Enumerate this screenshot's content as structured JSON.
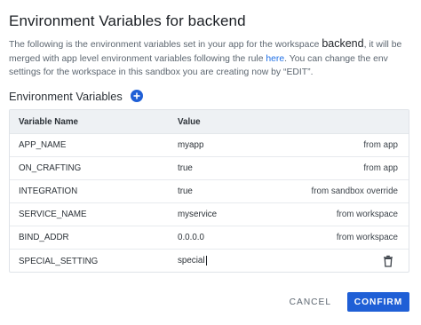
{
  "dialog": {
    "title": "Environment Variables for backend",
    "description": {
      "part1": "The following is the environment variables set in your app for the workspace ",
      "workspace": "backend",
      "part2": ", it will be merged with app level environment variables following the rule ",
      "link": "here",
      "part3": ". You can change the env settings for the workspace in this sandbox you are creating now by “EDIT”."
    }
  },
  "section": {
    "label": "Environment Variables",
    "add_icon": "plus-circle-icon"
  },
  "table": {
    "headers": {
      "name": "Variable Name",
      "value": "Value"
    },
    "rows": [
      {
        "name": "APP_NAME",
        "value": "myapp",
        "source": "from app"
      },
      {
        "name": "ON_CRAFTING",
        "value": "true",
        "source": "from app"
      },
      {
        "name": "INTEGRATION",
        "value": "true",
        "source": "from sandbox override"
      },
      {
        "name": "SERVICE_NAME",
        "value": "myservice",
        "source": "from workspace"
      },
      {
        "name": "BIND_ADDR",
        "value": "0.0.0.0",
        "source": "from workspace"
      }
    ],
    "editing_row": {
      "name": "SPECIAL_SETTING",
      "value": "special",
      "action_icon": "trash-icon"
    }
  },
  "footer": {
    "cancel_label": "CANCEL",
    "confirm_label": "CONFIRM"
  },
  "colors": {
    "accent": "#1f5fd6",
    "link": "#1f6fe5",
    "header_bg": "#eef1f4"
  }
}
